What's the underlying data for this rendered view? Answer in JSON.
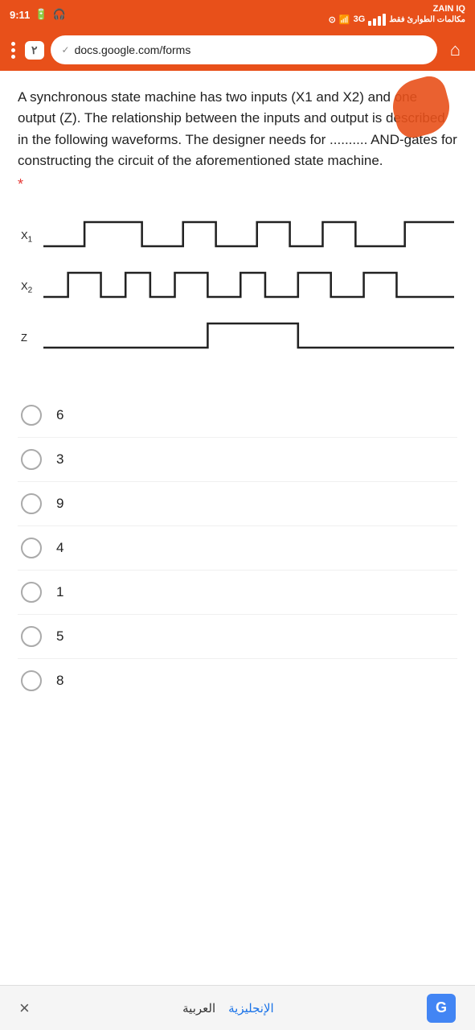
{
  "statusBar": {
    "time": "9:11",
    "batteryLabel": "battery",
    "signalLabel": "signal",
    "wifiLabel": "wifi",
    "networkLabel": "3G",
    "providerName": "ZAIN IQ",
    "providerSubtext": "مكالمات الطوارئ فقط"
  },
  "browserBar": {
    "tabCount": "٢",
    "url": "docs.google.com/forms",
    "homeLabel": "home"
  },
  "question": {
    "body": "A synchronous state machine has two inputs (X1 and X2) and one output (Z). The relationship between the inputs and output is described in the following waveforms. The designer needs for .......... AND-gates for constructing the circuit of the aforementioned state machine.",
    "requiredStar": "*"
  },
  "waveform": {
    "x1Label": "X₁",
    "x2Label": "X₂",
    "zLabel": "Z"
  },
  "options": [
    {
      "value": "6",
      "label": "6"
    },
    {
      "value": "3",
      "label": "3"
    },
    {
      "value": "9",
      "label": "9"
    },
    {
      "value": "4",
      "label": "4"
    },
    {
      "value": "1",
      "label": "1"
    },
    {
      "value": "5",
      "label": "5"
    },
    {
      "value": "8",
      "label": "8"
    }
  ],
  "bottomBar": {
    "closeLabel": "×",
    "menuLabel": "⋮",
    "langArabic": "العربية",
    "langEnglish": "الإنجليزية",
    "googleLabel": "G"
  }
}
